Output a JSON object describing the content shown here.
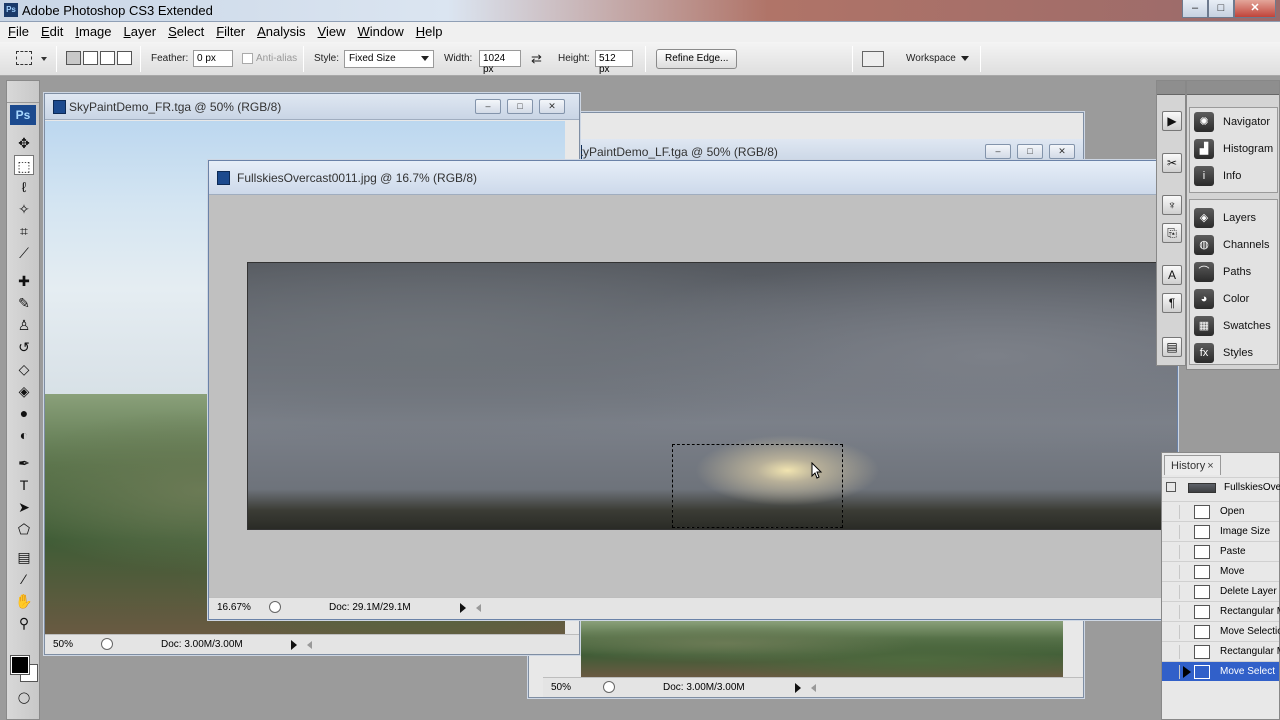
{
  "app": {
    "title": "Adobe Photoshop CS3 Extended",
    "logo_text": "Ps",
    "window_buttons": {
      "minimize": "–",
      "maximize": "□",
      "close": "✕"
    }
  },
  "menu": [
    "File",
    "Edit",
    "Image",
    "Layer",
    "Select",
    "Filter",
    "Analysis",
    "View",
    "Window",
    "Help"
  ],
  "options": {
    "feather_label": "Feather:",
    "feather_value": "0 px",
    "antialias_label": "Anti-alias",
    "style_label": "Style:",
    "style_value": "Fixed Size",
    "width_label": "Width:",
    "width_value": "1024 px",
    "swap_icon": "⇄",
    "height_label": "Height:",
    "height_value": "512 px",
    "refine_edge_label": "Refine Edge...",
    "workspace_label": "Workspace"
  },
  "toolbox": {
    "badge": "Ps",
    "tools": [
      {
        "name": "move-tool-icon",
        "glyph": "✥"
      },
      {
        "name": "rect-marquee-tool-icon",
        "glyph": "⬚"
      },
      {
        "name": "lasso-tool-icon",
        "glyph": "ℓ"
      },
      {
        "name": "magic-wand-tool-icon",
        "glyph": "✧"
      },
      {
        "name": "crop-tool-icon",
        "glyph": "⌗"
      },
      {
        "name": "slice-tool-icon",
        "glyph": "⟋"
      },
      {
        "name": "healing-brush-tool-icon",
        "glyph": "✚"
      },
      {
        "name": "brush-tool-icon",
        "glyph": "✎"
      },
      {
        "name": "clone-stamp-tool-icon",
        "glyph": "♙"
      },
      {
        "name": "history-brush-tool-icon",
        "glyph": "↺"
      },
      {
        "name": "eraser-tool-icon",
        "glyph": "◇"
      },
      {
        "name": "paint-bucket-tool-icon",
        "glyph": "◈"
      },
      {
        "name": "blur-tool-icon",
        "glyph": "●"
      },
      {
        "name": "dodge-tool-icon",
        "glyph": "◐"
      },
      {
        "name": "pen-tool-icon",
        "glyph": "✒"
      },
      {
        "name": "type-tool-icon",
        "glyph": "T"
      },
      {
        "name": "path-selection-tool-icon",
        "glyph": "➤"
      },
      {
        "name": "shape-tool-icon",
        "glyph": "⬠"
      },
      {
        "name": "notes-tool-icon",
        "glyph": "▤"
      },
      {
        "name": "eyedropper-tool-icon",
        "glyph": "⁄"
      },
      {
        "name": "hand-tool-icon",
        "glyph": "✋"
      },
      {
        "name": "zoom-tool-icon",
        "glyph": "⚲"
      }
    ]
  },
  "documents": {
    "fr": {
      "title": "SkyPaintDemo_FR.tga @ 50% (RGB/8)",
      "zoom": "50%",
      "doc": "Doc: 3.00M/3.00M"
    },
    "lf": {
      "title": "kyPaintDemo_LF.tga @ 50% (RGB/8)",
      "zoom": "50%",
      "doc": "Doc: 3.00M/3.00M"
    },
    "main": {
      "title": "FullskiesOvercast0011.jpg @ 16.7% (RGB/8)",
      "zoom": "16.67%",
      "doc": "Doc: 29.1M/29.1M"
    }
  },
  "dock": {
    "group1": [
      {
        "label": "Navigator",
        "icon": "navigator-icon",
        "glyph": "✺"
      },
      {
        "label": "Histogram",
        "icon": "histogram-icon",
        "glyph": "▟"
      },
      {
        "label": "Info",
        "icon": "info-icon",
        "glyph": "i"
      }
    ],
    "group2": [
      {
        "label": "Layers",
        "icon": "layers-icon",
        "glyph": "◈"
      },
      {
        "label": "Channels",
        "icon": "channels-icon",
        "glyph": "◍"
      },
      {
        "label": "Paths",
        "icon": "paths-icon",
        "glyph": "⌒"
      },
      {
        "label": "Color",
        "icon": "color-icon",
        "glyph": "◕"
      },
      {
        "label": "Swatches",
        "icon": "swatches-icon",
        "glyph": "▦"
      },
      {
        "label": "Styles",
        "icon": "styles-icon",
        "glyph": "fx"
      }
    ]
  },
  "strip_icons": [
    {
      "name": "actions-icon",
      "glyph": "▶"
    },
    {
      "name": "tool-presets-icon",
      "glyph": "✂"
    },
    {
      "name": "brushes-icon",
      "glyph": "♆"
    },
    {
      "name": "clone-source-icon",
      "glyph": "⎘"
    },
    {
      "name": "character-icon",
      "glyph": "A"
    },
    {
      "name": "paragraph-icon",
      "glyph": "¶"
    },
    {
      "name": "layer-comps-icon",
      "glyph": "▤"
    }
  ],
  "history": {
    "tab": "History",
    "snapshot": "FullskiesOve",
    "items": [
      {
        "label": "Open",
        "active": false
      },
      {
        "label": "Image Size",
        "active": false
      },
      {
        "label": "Paste",
        "active": false
      },
      {
        "label": "Move",
        "active": false
      },
      {
        "label": "Delete Layer",
        "active": false
      },
      {
        "label": "Rectangular M",
        "active": false
      },
      {
        "label": "Move Selectio",
        "active": false
      },
      {
        "label": "Rectangular M",
        "active": false
      },
      {
        "label": "Move Select",
        "active": true
      }
    ]
  }
}
